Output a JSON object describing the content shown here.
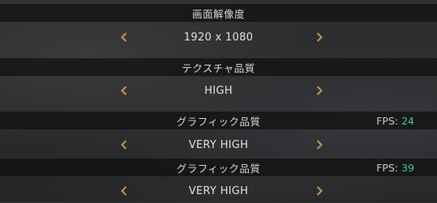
{
  "settings": [
    {
      "title": "画面解像度",
      "value": "1920 x 1080",
      "fps_label": "",
      "fps_value": ""
    },
    {
      "title": "テクスチャ品質",
      "value": "HIGH",
      "fps_label": "",
      "fps_value": ""
    },
    {
      "title": "グラフィック品質",
      "value": "VERY HIGH",
      "fps_label": "FPS:",
      "fps_value": "24"
    },
    {
      "title": "グラフィック品質",
      "value": "VERY HIGH",
      "fps_label": "FPS:",
      "fps_value": "39"
    }
  ],
  "colors": {
    "arrow": "#c9924a",
    "fps_value_1": "#3fd07a",
    "fps_value_2": "#36c98c"
  },
  "icons": {
    "prev": "chevron-left-icon",
    "next": "chevron-right-icon"
  }
}
